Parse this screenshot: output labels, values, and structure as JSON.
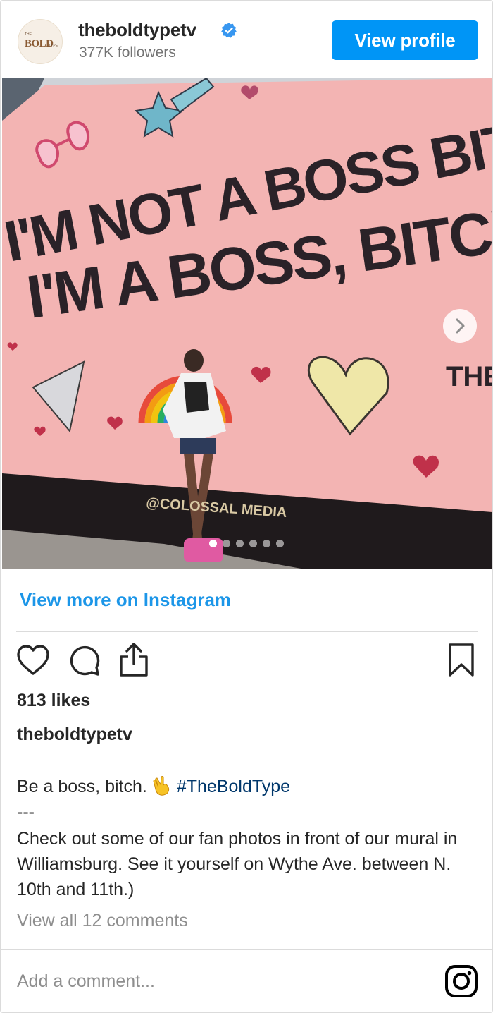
{
  "header": {
    "avatar_alt": "BOLD TYPE",
    "username": "theboldtypetv",
    "followers": "377K followers",
    "view_profile_label": "View profile"
  },
  "photo": {
    "mural_line1": "I'M NOT A BOSS BITCH",
    "mural_line2": "I'M A BOSS, BITCH.",
    "mural_side_text": "THE",
    "mural_credit": "@COLOSSAL MEDIA",
    "carousel_total": 6,
    "carousel_active": 1
  },
  "view_more_label": "View more on Instagram",
  "likes": "813 likes",
  "caption": {
    "username": "theboldtypetv",
    "line1_text": "Be a boss, bitch.",
    "hashtag": "#TheBoldType",
    "separator": "---",
    "body": "Check out some of our fan photos in front of our mural in Williamsburg. See it yourself on Wythe Ave. between N. 10th and 11th.)"
  },
  "view_comments_label": "View all 12 comments",
  "add_comment_placeholder": "Add a comment...",
  "colors": {
    "accent": "#0095f6",
    "link": "#1c96e8",
    "hashtag": "#00376b",
    "mural_pink": "#f5b5b5"
  },
  "icons": [
    "verified-badge-icon",
    "heart-icon",
    "comment-icon",
    "share-icon",
    "bookmark-icon",
    "instagram-icon",
    "chevron-right-icon"
  ]
}
